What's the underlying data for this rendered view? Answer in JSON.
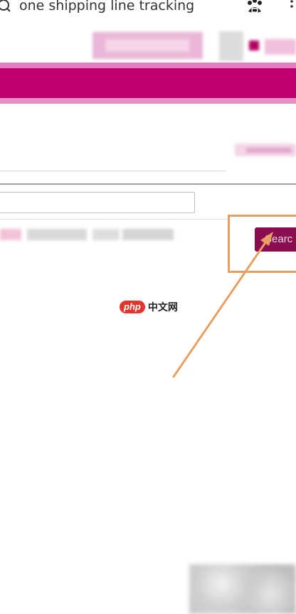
{
  "search": {
    "query": "one shipping line tracking"
  },
  "tracking_form": {
    "input_value": "",
    "search_button_label": "Searc"
  },
  "watermark": {
    "logo": "php",
    "text": "中文网"
  },
  "icons": {
    "search": "search-icon",
    "baidu": "baidu-paw-icon",
    "more": "more-vertical-icon"
  },
  "colors": {
    "brand_magenta": "#c3006f",
    "band_light": "#e37fc1",
    "button": "#8b0c4f",
    "annotation": "#e8a062"
  }
}
